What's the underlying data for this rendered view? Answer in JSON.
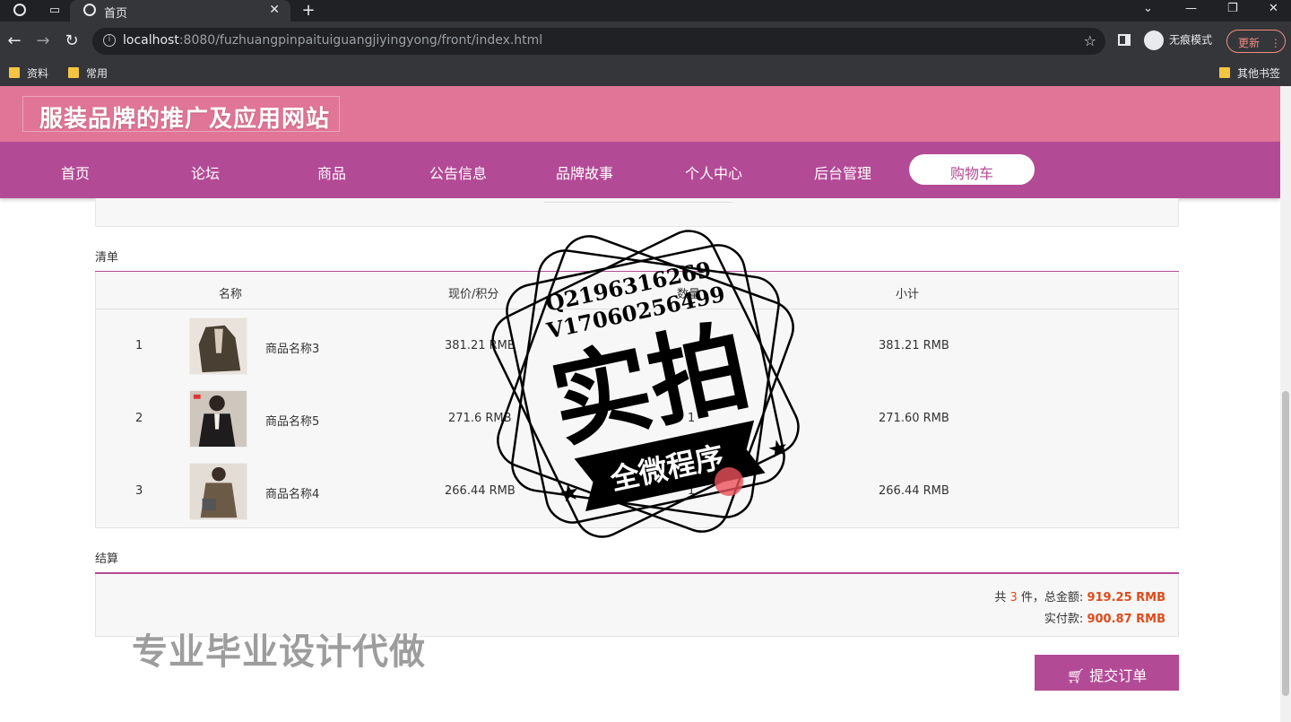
{
  "browser": {
    "tab_title": "首页",
    "url_host": "localhost",
    "url_rest": ":8080/fuzhuangpinpaituiguangjiyingyong/front/index.html",
    "incognito_label": "无痕模式",
    "update_label": "更新",
    "bookmarks": [
      "资料",
      "常用"
    ],
    "other_bookmarks": "其他书签"
  },
  "site": {
    "title": "服装品牌的推广及应用网站",
    "nav": [
      "首页",
      "论坛",
      "商品",
      "公告信息",
      "品牌故事",
      "个人中心",
      "后台管理",
      "购物车"
    ],
    "active_nav": "购物车"
  },
  "cart": {
    "section_label": "清单",
    "headers": {
      "name": "名称",
      "price": "现价/积分",
      "qty": "数量",
      "subtotal": "小计"
    },
    "rows": [
      {
        "index": "1",
        "name": "商品名称3",
        "price": "381.21 RMB",
        "qty": "",
        "subtotal": "381.21 RMB"
      },
      {
        "index": "2",
        "name": "商品名称5",
        "price": "271.6 RMB",
        "qty": "1",
        "subtotal": "271.60 RMB"
      },
      {
        "index": "3",
        "name": "商品名称4",
        "price": "266.44 RMB",
        "qty": "1",
        "subtotal": "266.44 RMB"
      }
    ]
  },
  "settlement": {
    "section_label": "结算",
    "count_prefix": "共",
    "count": "3",
    "count_suffix": "件，总金额:",
    "total": "919.25 RMB",
    "paid_label": "实付款:",
    "paid": "900.87 RMB",
    "submit_label": "提交订单"
  },
  "watermark": {
    "line1": "Q2196316269",
    "line2": "V17060256499",
    "main": "实拍",
    "ribbon": "全微程序",
    "bottom": "专业毕业设计代做"
  },
  "colors": {
    "brand_pink": "#e07597",
    "brand_purple": "#b34a96",
    "price_red": "#e04a1a"
  }
}
